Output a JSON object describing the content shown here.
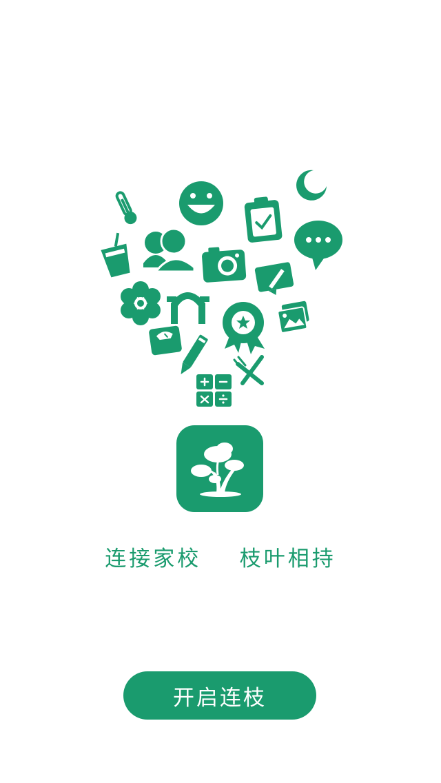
{
  "colors": {
    "brand": "#1a9b6e",
    "background": "#ffffff"
  },
  "icons": [
    "thermometer-icon",
    "smiley-icon",
    "clipboard-check-icon",
    "moon-icon",
    "drink-cup-icon",
    "people-icon",
    "camera-icon",
    "chat-bubble-icon",
    "edit-note-icon",
    "flower-icon",
    "arch-icon",
    "award-badge-icon",
    "pictures-icon",
    "scale-icon",
    "pencil-icon",
    "fork-knife-icon",
    "calculator-icon",
    "tree-logo-icon"
  ],
  "slogan": "连接家校    枝叶相持",
  "start_button_label": "开启连枝"
}
